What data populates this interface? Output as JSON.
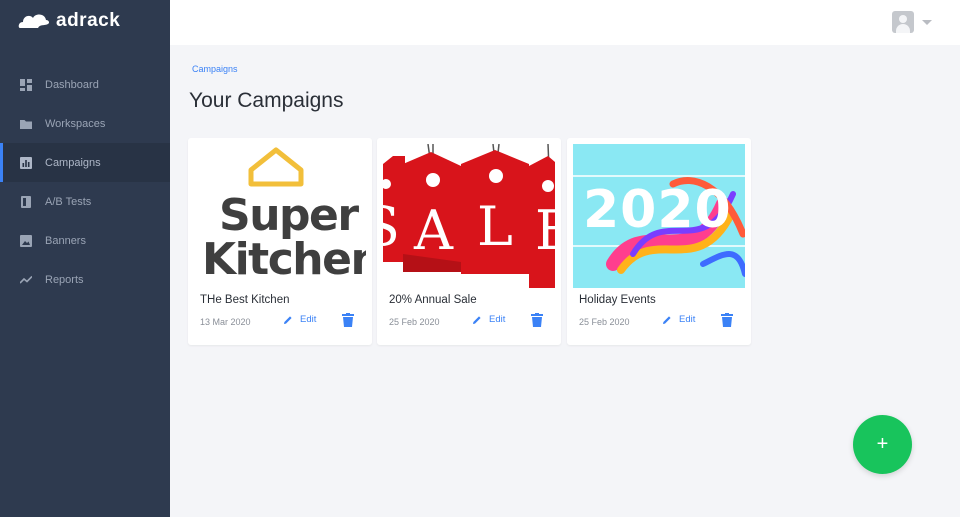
{
  "app": {
    "name": "adrack",
    "logo_icon": "cloud-logo-icon"
  },
  "sidebar": {
    "items": [
      {
        "label": "Dashboard",
        "icon": "dashboard-icon",
        "active": false
      },
      {
        "label": "Workspaces",
        "icon": "folder-icon",
        "active": false
      },
      {
        "label": "Campaigns",
        "icon": "bar-chart-icon",
        "active": true
      },
      {
        "label": "A/B Tests",
        "icon": "ab-test-icon",
        "active": false
      },
      {
        "label": "Banners",
        "icon": "image-icon",
        "active": false
      },
      {
        "label": "Reports",
        "icon": "trend-line-icon",
        "active": false
      }
    ]
  },
  "header": {
    "user_avatar": "user-avatar-icon",
    "menu_caret": "caret-down-icon"
  },
  "breadcrumb": "Campaigns",
  "page_title": "Your Campaigns",
  "campaigns": [
    {
      "title": "THe Best Kitchen",
      "date": "13 Mar 2020",
      "edit_label": "Edit",
      "thumb_text": [
        "Super",
        "Kitchen"
      ]
    },
    {
      "title": "20% Annual Sale",
      "date": "25 Feb 2020",
      "edit_label": "Edit",
      "thumb_text": [
        "S",
        "A",
        "L",
        "E"
      ]
    },
    {
      "title": "Holiday Events",
      "date": "25 Feb 2020",
      "edit_label": "Edit",
      "thumb_text": [
        "2020"
      ]
    }
  ],
  "fab": {
    "label": "+"
  },
  "colors": {
    "sidebar": "#2e3a4f",
    "accent": "#3b82f6",
    "fab": "#18c45c",
    "sale_red": "#d8141b",
    "sky": "#8ae8f3"
  }
}
